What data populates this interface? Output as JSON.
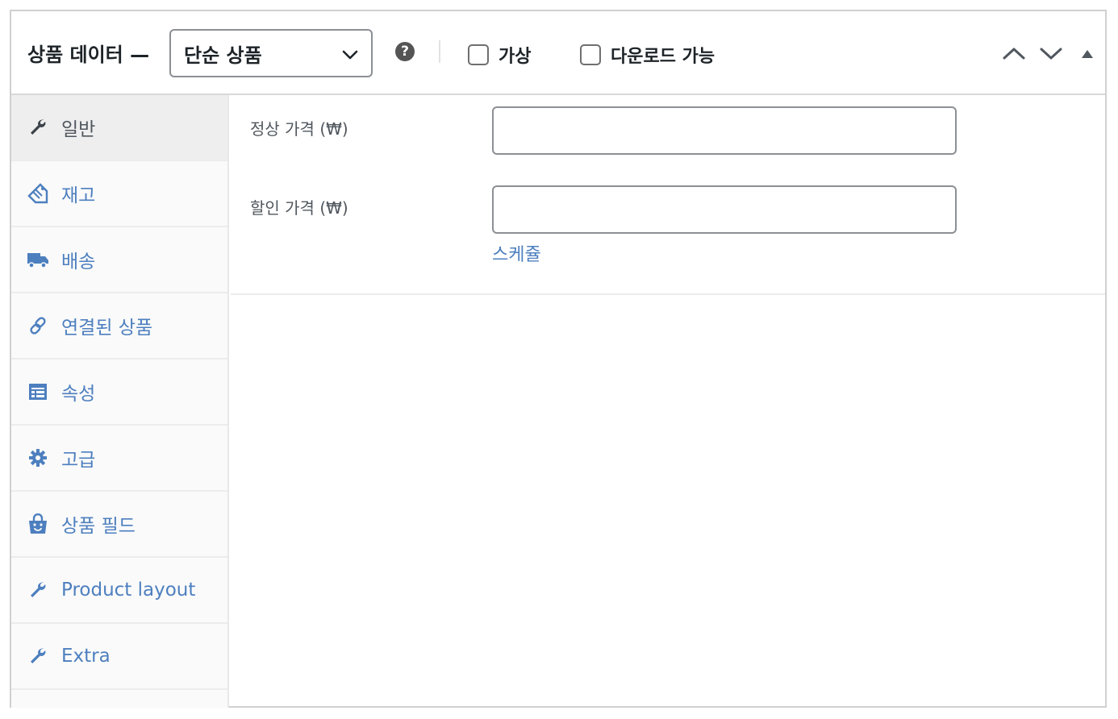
{
  "header": {
    "title": "상품 데이터 —",
    "product_type": {
      "selected": "단순 상품"
    },
    "help_icon": "question-circle-icon",
    "checkboxes": [
      {
        "label": "가상",
        "checked": false
      },
      {
        "label": "다운로드 가능",
        "checked": false
      }
    ],
    "controls": [
      "move-up-icon",
      "move-down-icon",
      "collapse-toggle-icon"
    ]
  },
  "tabs": [
    {
      "label": "일반",
      "icon": "wrench-icon",
      "active": true
    },
    {
      "label": "재고",
      "icon": "tag-icon",
      "active": false
    },
    {
      "label": "배송",
      "icon": "truck-icon",
      "active": false
    },
    {
      "label": "연결된 상품",
      "icon": "link-icon",
      "active": false
    },
    {
      "label": "속성",
      "icon": "list-table-icon",
      "active": false
    },
    {
      "label": "고급",
      "icon": "gear-icon",
      "active": false
    },
    {
      "label": "상품 필드",
      "icon": "shopping-bag-icon",
      "active": false
    },
    {
      "label": "Product layout",
      "icon": "wrench-icon",
      "active": false
    },
    {
      "label": "Extra",
      "icon": "wrench-icon",
      "active": false
    }
  ],
  "general": {
    "regular_price": {
      "label": "정상 가격 (₩)",
      "value": ""
    },
    "sale_price": {
      "label": "할인 가격 (₩)",
      "value": ""
    },
    "schedule_link": "스케쥴"
  },
  "colors": {
    "link": "#4d7fbf",
    "text": "#1d2327",
    "muted": "#50575e",
    "border": "#8c8f94"
  }
}
